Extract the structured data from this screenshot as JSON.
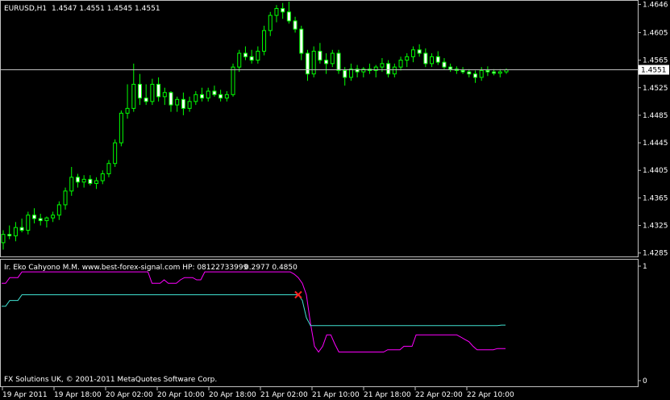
{
  "header": {
    "symbol": "EURUSD,H1",
    "ohlc": "1.4547 1.4551 1.4545 1.4551"
  },
  "indicator": {
    "title": "Ir. Eko Cahyono M.M. www.best-forex-signal.com HP: 08122733999",
    "values": "0.2977 0.4850"
  },
  "footer": {
    "copyright": "FX Solutions UK, © 2001-2011 MetaQuotes Software Corp."
  },
  "colors": {
    "background": "#000000",
    "frame": "#c0c0c0",
    "bull": "#00ff00",
    "bear": "#ffffff",
    "line_magenta": "#ff00ff",
    "line_cyan": "#40e0d0",
    "signal": "#ff2020",
    "price_line": "#c0c0c0"
  },
  "current_price": "1.4551",
  "chart_data": [
    {
      "type": "candlestick",
      "ylim": [
        1.428,
        1.465
      ],
      "yticks": [
        "1.4646",
        "1.4605",
        "1.4565",
        "1.4525",
        "1.4485",
        "1.4445",
        "1.4405",
        "1.4365",
        "1.4325",
        "1.4285"
      ],
      "xticks": [
        "19 Apr 2011",
        "19 Apr 18:00",
        "20 Apr 02:00",
        "20 Apr 10:00",
        "20 Apr 18:00",
        "21 Apr 02:00",
        "21 Apr 10:00",
        "21 Apr 18:00",
        "22 Apr 02:00",
        "22 Apr 10:00"
      ],
      "price_line": 1.4551,
      "candles": [
        [
          1.43,
          1.4318,
          1.429,
          1.4312
        ],
        [
          1.4312,
          1.4325,
          1.4305,
          1.431
        ],
        [
          1.431,
          1.433,
          1.4302,
          1.4322
        ],
        [
          1.4322,
          1.4335,
          1.4315,
          1.4318
        ],
        [
          1.4318,
          1.4345,
          1.4312,
          1.434
        ],
        [
          1.434,
          1.435,
          1.4328,
          1.4335
        ],
        [
          1.4335,
          1.4342,
          1.4325,
          1.4332
        ],
        [
          1.4332,
          1.4338,
          1.4322,
          1.4336
        ],
        [
          1.4336,
          1.4345,
          1.433,
          1.434
        ],
        [
          1.434,
          1.436,
          1.4333,
          1.4355
        ],
        [
          1.4355,
          1.438,
          1.4348,
          1.4375
        ],
        [
          1.4375,
          1.441,
          1.4368,
          1.4395
        ],
        [
          1.4395,
          1.44,
          1.438,
          1.4388
        ],
        [
          1.4388,
          1.4398,
          1.438,
          1.4392
        ],
        [
          1.4392,
          1.4398,
          1.4383,
          1.4386
        ],
        [
          1.4386,
          1.4395,
          1.4378,
          1.439
        ],
        [
          1.439,
          1.4405,
          1.4385,
          1.44
        ],
        [
          1.44,
          1.442,
          1.4395,
          1.4415
        ],
        [
          1.4415,
          1.445,
          1.441,
          1.4445
        ],
        [
          1.4445,
          1.4492,
          1.444,
          1.4488
        ],
        [
          1.4488,
          1.453,
          1.448,
          1.4495
        ],
        [
          1.4495,
          1.456,
          1.449,
          1.453
        ],
        [
          1.453,
          1.4545,
          1.45,
          1.451
        ],
        [
          1.451,
          1.453,
          1.45,
          1.4505
        ],
        [
          1.4505,
          1.4538,
          1.45,
          1.453
        ],
        [
          1.453,
          1.454,
          1.4505,
          1.4512
        ],
        [
          1.4512,
          1.4525,
          1.45,
          1.4518
        ],
        [
          1.4518,
          1.452,
          1.449,
          1.45
        ],
        [
          1.45,
          1.4512,
          1.449,
          1.4508
        ],
        [
          1.4508,
          1.4518,
          1.4485,
          1.4495
        ],
        [
          1.4495,
          1.4512,
          1.449,
          1.4505
        ],
        [
          1.4505,
          1.452,
          1.45,
          1.4515
        ],
        [
          1.4515,
          1.4525,
          1.4505,
          1.451
        ],
        [
          1.451,
          1.4525,
          1.4505,
          1.452
        ],
        [
          1.452,
          1.4528,
          1.4512,
          1.4515
        ],
        [
          1.4515,
          1.4522,
          1.4505,
          1.451
        ],
        [
          1.451,
          1.452,
          1.4505,
          1.4515
        ],
        [
          1.4515,
          1.456,
          1.4512,
          1.4555
        ],
        [
          1.4555,
          1.458,
          1.4548,
          1.4575
        ],
        [
          1.4575,
          1.4585,
          1.4565,
          1.457
        ],
        [
          1.457,
          1.458,
          1.456,
          1.4565
        ],
        [
          1.4565,
          1.4585,
          1.456,
          1.4578
        ],
        [
          1.4578,
          1.4615,
          1.4572,
          1.4608
        ],
        [
          1.4608,
          1.4635,
          1.46,
          1.463
        ],
        [
          1.463,
          1.4645,
          1.462,
          1.464
        ],
        [
          1.464,
          1.4648,
          1.4625,
          1.4635
        ],
        [
          1.4635,
          1.465,
          1.4618,
          1.4622
        ],
        [
          1.4622,
          1.4628,
          1.4605,
          1.461
        ],
        [
          1.461,
          1.4615,
          1.4565,
          1.4575
        ],
        [
          1.4575,
          1.458,
          1.4535,
          1.4545
        ],
        [
          1.4545,
          1.4585,
          1.454,
          1.4578
        ],
        [
          1.4578,
          1.459,
          1.456,
          1.4565
        ],
        [
          1.4565,
          1.4575,
          1.4545,
          1.456
        ],
        [
          1.456,
          1.458,
          1.4555,
          1.4575
        ],
        [
          1.4575,
          1.458,
          1.4545,
          1.455
        ],
        [
          1.455,
          1.4555,
          1.4528,
          1.454
        ],
        [
          1.454,
          1.456,
          1.4535,
          1.4552
        ],
        [
          1.4552,
          1.4558,
          1.454,
          1.4548
        ],
        [
          1.4548,
          1.4555,
          1.454,
          1.4552
        ],
        [
          1.4552,
          1.456,
          1.4545,
          1.455
        ],
        [
          1.455,
          1.4558,
          1.454,
          1.4555
        ],
        [
          1.4555,
          1.4568,
          1.4548,
          1.456
        ],
        [
          1.456,
          1.4565,
          1.454,
          1.4545
        ],
        [
          1.4545,
          1.456,
          1.454,
          1.4555
        ],
        [
          1.4555,
          1.457,
          1.455,
          1.4565
        ],
        [
          1.4565,
          1.4575,
          1.4555,
          1.457
        ],
        [
          1.457,
          1.4585,
          1.4562,
          1.458
        ],
        [
          1.458,
          1.4588,
          1.457,
          1.4575
        ],
        [
          1.4575,
          1.4582,
          1.4555,
          1.456
        ],
        [
          1.456,
          1.4575,
          1.4555,
          1.457
        ],
        [
          1.457,
          1.4578,
          1.4558,
          1.4562
        ],
        [
          1.4562,
          1.4568,
          1.4552,
          1.4555
        ],
        [
          1.4555,
          1.456,
          1.4548,
          1.4552
        ],
        [
          1.4552,
          1.4556,
          1.4545,
          1.455
        ],
        [
          1.455,
          1.4555,
          1.4545,
          1.4548
        ],
        [
          1.4548,
          1.4552,
          1.454,
          1.4545
        ],
        [
          1.4545,
          1.455,
          1.4532,
          1.454
        ],
        [
          1.454,
          1.4555,
          1.4535,
          1.455
        ],
        [
          1.455,
          1.4556,
          1.4542,
          1.4548
        ],
        [
          1.4548,
          1.4552,
          1.4543,
          1.4546
        ],
        [
          1.4546,
          1.4552,
          1.454,
          1.4548
        ],
        [
          1.4548,
          1.4553,
          1.4545,
          1.4551
        ]
      ]
    },
    {
      "type": "line",
      "ylim": [
        0,
        1
      ],
      "yticks": [
        "1",
        "0"
      ],
      "series": [
        {
          "color": "#ff00ff",
          "values": [
            0.85,
            0.85,
            0.9,
            0.9,
            0.9,
            0.95,
            0.95,
            0.95,
            0.95,
            0.95,
            0.95,
            0.95,
            0.95,
            0.95,
            0.95,
            0.95,
            0.95,
            0.95,
            0.95,
            0.95,
            0.95,
            0.95,
            0.95,
            0.95,
            0.95,
            0.95,
            0.95,
            0.95,
            0.95,
            0.95,
            0.95,
            0.95,
            0.95,
            0.95,
            0.95,
            0.95,
            0.95,
            0.85,
            0.85,
            0.85,
            0.88,
            0.85,
            0.85,
            0.85,
            0.88,
            0.9,
            0.9,
            0.9,
            0.88,
            0.88,
            0.95,
            0.95,
            0.95,
            0.95,
            0.95,
            0.95,
            0.95,
            0.95,
            0.95,
            0.95,
            0.95,
            0.95,
            0.95,
            0.95,
            0.95,
            0.95,
            0.95,
            0.95,
            0.95,
            0.95,
            0.95,
            0.95,
            0.93,
            0.9,
            0.85,
            0.75,
            0.5,
            0.3,
            0.25,
            0.3,
            0.4,
            0.4,
            0.32,
            0.25,
            0.25,
            0.25,
            0.25,
            0.25,
            0.25,
            0.25,
            0.25,
            0.25,
            0.25,
            0.25,
            0.25,
            0.27,
            0.27,
            0.27,
            0.27,
            0.3,
            0.3,
            0.3,
            0.4,
            0.4,
            0.4,
            0.4,
            0.4,
            0.4,
            0.4,
            0.4,
            0.4,
            0.4,
            0.4,
            0.38,
            0.36,
            0.34,
            0.3,
            0.27,
            0.27,
            0.27,
            0.27,
            0.27,
            0.28,
            0.28,
            0.28
          ]
        },
        {
          "color": "#40e0d0",
          "values": [
            0.65,
            0.65,
            0.7,
            0.7,
            0.7,
            0.75,
            0.75,
            0.75,
            0.75,
            0.75,
            0.75,
            0.75,
            0.75,
            0.75,
            0.75,
            0.75,
            0.75,
            0.75,
            0.75,
            0.75,
            0.75,
            0.75,
            0.75,
            0.75,
            0.75,
            0.75,
            0.75,
            0.75,
            0.75,
            0.75,
            0.75,
            0.75,
            0.75,
            0.75,
            0.75,
            0.75,
            0.75,
            0.75,
            0.75,
            0.75,
            0.75,
            0.75,
            0.75,
            0.75,
            0.75,
            0.75,
            0.75,
            0.75,
            0.75,
            0.75,
            0.75,
            0.75,
            0.75,
            0.75,
            0.75,
            0.75,
            0.75,
            0.75,
            0.75,
            0.75,
            0.75,
            0.75,
            0.75,
            0.75,
            0.75,
            0.75,
            0.75,
            0.75,
            0.75,
            0.75,
            0.75,
            0.75,
            0.75,
            0.75,
            0.7,
            0.55,
            0.48,
            0.48,
            0.48,
            0.48,
            0.48,
            0.48,
            0.48,
            0.48,
            0.48,
            0.48,
            0.48,
            0.48,
            0.48,
            0.48,
            0.48,
            0.48,
            0.48,
            0.48,
            0.48,
            0.48,
            0.48,
            0.48,
            0.48,
            0.48,
            0.48,
            0.48,
            0.48,
            0.48,
            0.48,
            0.48,
            0.48,
            0.48,
            0.48,
            0.48,
            0.48,
            0.48,
            0.48,
            0.48,
            0.48,
            0.48,
            0.48,
            0.48,
            0.48,
            0.48,
            0.48,
            0.48,
            0.48,
            0.485,
            0.485
          ]
        }
      ],
      "signal_index": 73
    }
  ]
}
